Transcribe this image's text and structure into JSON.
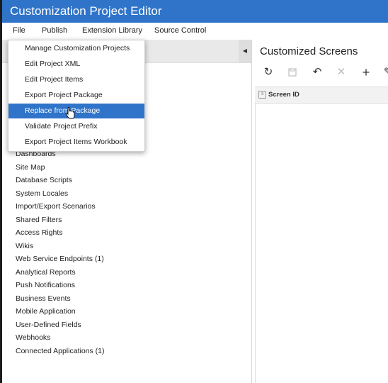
{
  "window": {
    "title": "Customization Project Editor"
  },
  "menubar": {
    "items": [
      "File",
      "Publish",
      "Extension Library",
      "Source Control"
    ]
  },
  "file_menu": {
    "items": [
      "Manage Customization Projects",
      "Edit Project XML",
      "Edit Project Items",
      "Export Project Package",
      "Replace from Package",
      "Validate Project Prefix",
      "Export Project Items Workbook"
    ],
    "selected_index": 4
  },
  "tree": {
    "items": [
      "Dashboards",
      "Site Map",
      "Database Scripts",
      "System Locales",
      "Import/Export Scenarios",
      "Shared Filters",
      "Access Rights",
      "Wikis",
      "Web Service Endpoints (1)",
      "Analytical Reports",
      "Push Notifications",
      "Business Events",
      "Mobile Application",
      "User-Defined Fields",
      "Webhooks",
      "Connected Applications (1)"
    ]
  },
  "right_panel": {
    "title": "Customized Screens",
    "toolbar_icons": [
      "refresh-icon",
      "save-icon",
      "undo-icon",
      "delete-icon",
      "add-icon",
      "edit-icon"
    ],
    "grid": {
      "columns": [
        "Screen ID"
      ]
    }
  }
}
